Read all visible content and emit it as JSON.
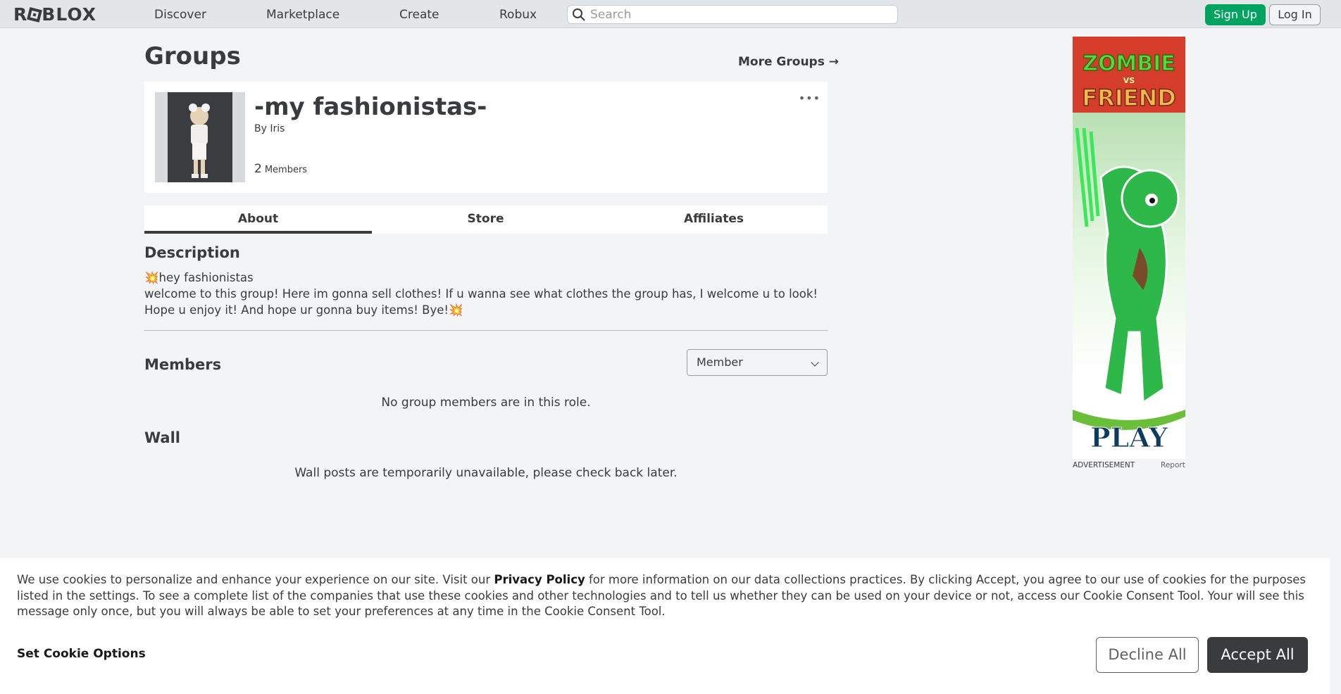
{
  "nav": {
    "logo_left": "R",
    "logo_right": "BLOX",
    "links": [
      "Discover",
      "Marketplace",
      "Create",
      "Robux"
    ],
    "search_placeholder": "Search",
    "signup": "Sign Up",
    "login": "Log In"
  },
  "page": {
    "title": "Groups",
    "more_groups": "More Groups →"
  },
  "group": {
    "name": "-my fashionistas-",
    "by_prefix": "By",
    "owner": "Iris",
    "member_count": "2",
    "members_label": "Members",
    "more_menu": "•••"
  },
  "tabs": [
    "About",
    "Store",
    "Affiliates"
  ],
  "description": {
    "heading": "Description",
    "line1": "💥hey fashionistas",
    "line2": "welcome to this group! Here im gonna sell clothes! If u wanna see what clothes the group has, I welcome u to look! Hope u enjoy it! And hope ur gonna buy items! Bye!💥"
  },
  "members": {
    "heading": "Members",
    "role": "Member",
    "empty": "No group members are in this role."
  },
  "wall": {
    "heading": "Wall",
    "empty": "Wall posts are temporarily unavailable, please check back later."
  },
  "ad": {
    "title_top": "ZOMBIE",
    "title_vs": "VS",
    "title_bottom": "FRIEND",
    "play": "PLAY",
    "label": "ADVERTISEMENT",
    "report": "Report"
  },
  "cookie": {
    "text_before": "We use cookies to personalize and enhance your experience on our site. Visit our ",
    "policy_link": "Privacy Policy",
    "text_after": " for more information on our data collections practices. By clicking Accept, you agree to our use of cookies for the purposes listed in the settings. To see a complete list of the companies that use these cookies and other technologies and to tell us whether they can be used on your device or not, access our Cookie Consent Tool. Your will see this message only once, but you will always be able to set your preferences at any time in the Cookie Consent Tool.",
    "set_options": "Set Cookie Options",
    "decline": "Decline All",
    "accept": "Accept All"
  }
}
